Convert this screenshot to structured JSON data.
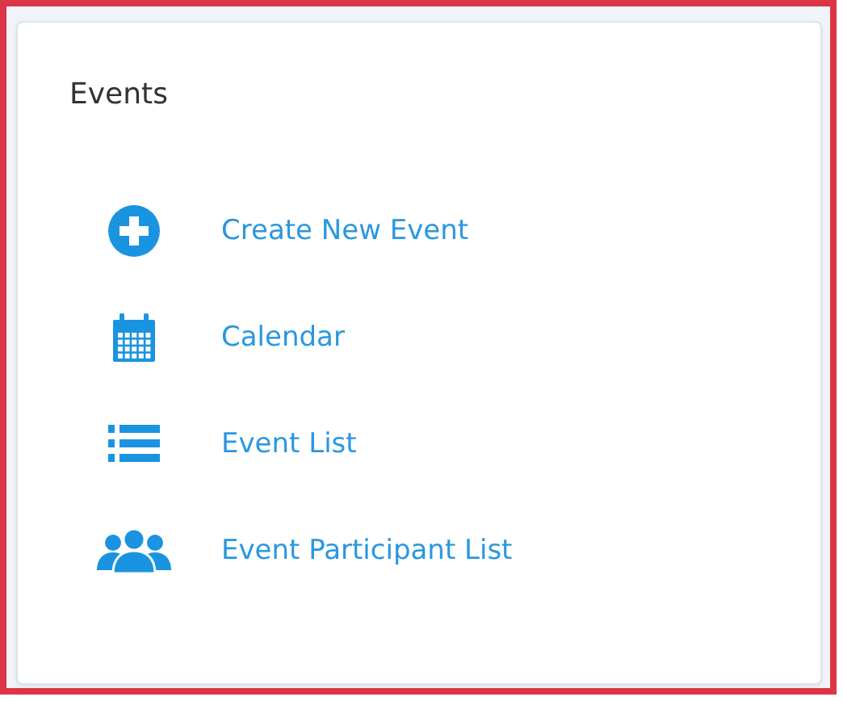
{
  "card": {
    "title": "Events",
    "links": [
      {
        "label": "Create New Event"
      },
      {
        "label": "Calendar"
      },
      {
        "label": "Event List"
      },
      {
        "label": "Event Participant List"
      }
    ]
  }
}
